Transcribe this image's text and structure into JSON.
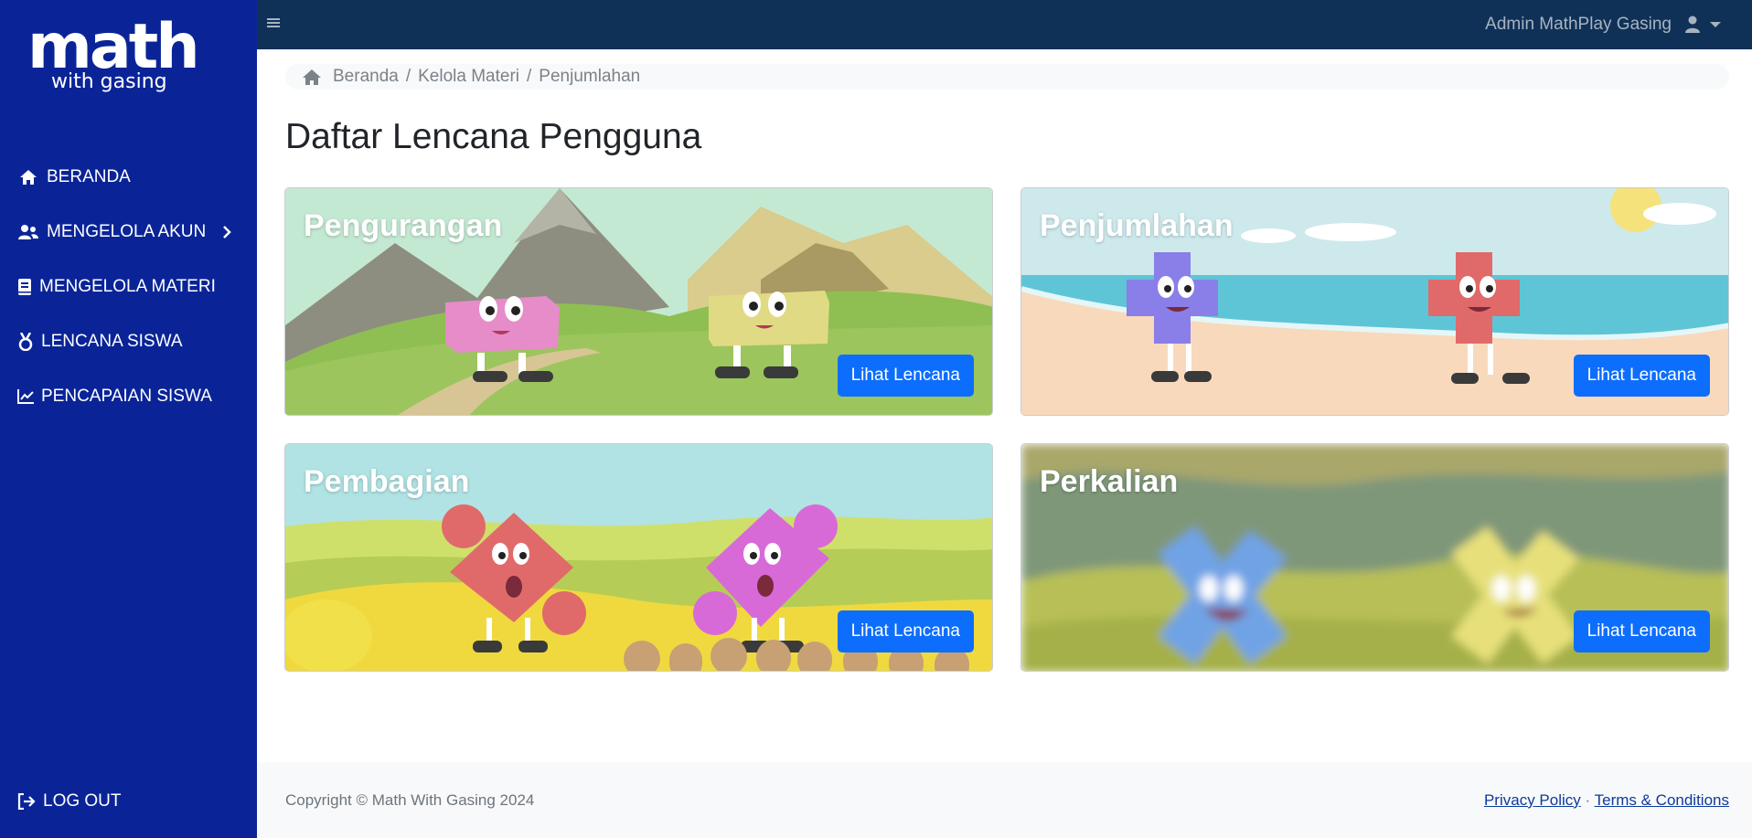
{
  "logo": {
    "main": "math",
    "sub": "with gasing"
  },
  "sidebar": {
    "items": [
      {
        "label": "BERANDA",
        "icon": "home-icon"
      },
      {
        "label": "MENGELOLA AKUN",
        "icon": "users-icon"
      },
      {
        "label": "MENGELOLA MATERI",
        "icon": "book-icon"
      },
      {
        "label": "LENCANA SISWA",
        "icon": "medal-icon"
      },
      {
        "label": "PENCAPAIAN SISWA",
        "icon": "chart-line-icon"
      }
    ],
    "logout": "LOG OUT"
  },
  "topbar": {
    "user_name": "Admin MathPlay Gasing"
  },
  "breadcrumb": {
    "items": [
      "Beranda",
      "Kelola Materi",
      "Penjumlahan"
    ],
    "separator": "/"
  },
  "page_title": "Daftar Lencana Pengguna",
  "cards": [
    {
      "title": "Pengurangan",
      "button": "Lihat Lencana"
    },
    {
      "title": "Penjumlahan",
      "button": "Lihat Lencana"
    },
    {
      "title": "Pembagian",
      "button": "Lihat Lencana"
    },
    {
      "title": "Perkalian",
      "button": "Lihat Lencana"
    }
  ],
  "footer": {
    "copyright": "Copyright © Math With Gasing 2024",
    "privacy": "Privacy Policy",
    "middot": "·",
    "terms": "Terms & Conditions"
  },
  "colors": {
    "sidebar": "#0a2498",
    "topbar": "#0f3158",
    "button": "#0d6efd"
  }
}
